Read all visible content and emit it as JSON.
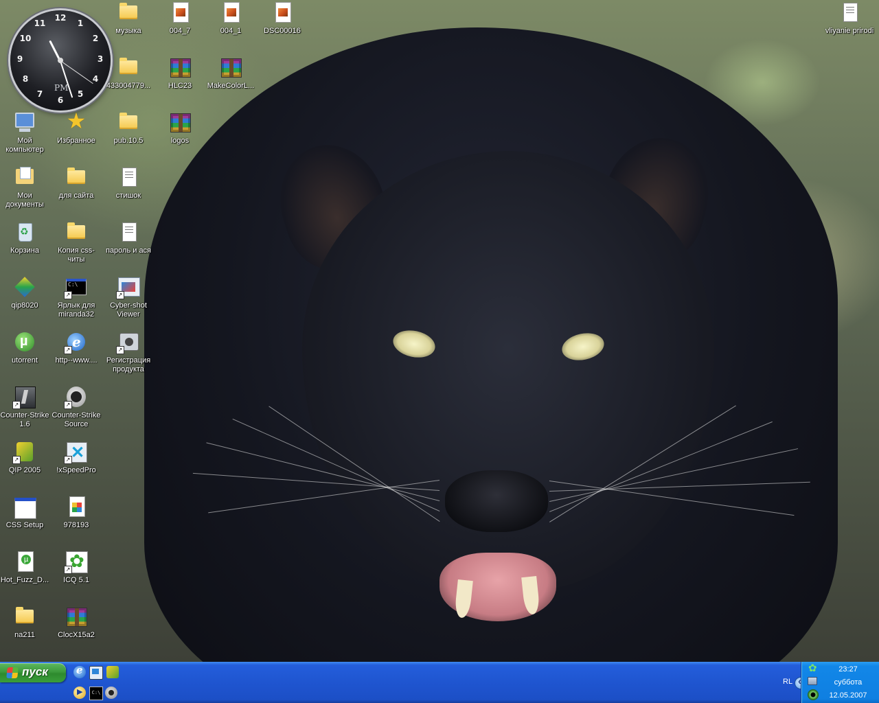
{
  "desktop": {
    "clock": {
      "numbers": [
        "12",
        "1",
        "2",
        "3",
        "4",
        "5",
        "6",
        "7",
        "8",
        "9",
        "10",
        "11"
      ],
      "meridiem": "PM"
    },
    "icons": [
      {
        "label": "музыка"
      },
      {
        "label": "004_7"
      },
      {
        "label": "004_1"
      },
      {
        "label": "DSC00016"
      },
      {
        "label": "vliyanie prirodi"
      },
      {
        "label": "433004779..."
      },
      {
        "label": "HLC23"
      },
      {
        "label": "MakeColorL..."
      },
      {
        "label": "Мой компьютер"
      },
      {
        "label": "Избранное"
      },
      {
        "label": "pub.10.5"
      },
      {
        "label": "logos"
      },
      {
        "label": "Мои документы"
      },
      {
        "label": "для сайта"
      },
      {
        "label": "стишок"
      },
      {
        "label": "Корзина"
      },
      {
        "label": "Копия css-читы"
      },
      {
        "label": "пароль и ася"
      },
      {
        "label": "qip8020"
      },
      {
        "label": "Ярлык для miranda32"
      },
      {
        "label": "Cyber-shot Viewer"
      },
      {
        "label": "utorrent"
      },
      {
        "label": "http--www...."
      },
      {
        "label": "Регистрация продукта"
      },
      {
        "label": "Counter-Strike 1.6"
      },
      {
        "label": "Counter-Strike Source"
      },
      {
        "label": "QIP 2005"
      },
      {
        "label": "!xSpeedPro"
      },
      {
        "label": "CSS Setup"
      },
      {
        "label": "978193"
      },
      {
        "label": "Hot_Fuzz_D..."
      },
      {
        "label": "ICQ 5.1"
      },
      {
        "label": "na211"
      },
      {
        "label": "ClocX15a2"
      }
    ]
  },
  "taskbar": {
    "start_label": "пуск",
    "quick_launch": [
      "internet-explorer-icon",
      "show-desktop-icon",
      "qip-icon",
      "media-player-icon",
      "command-prompt-icon",
      "counter-strike-icon"
    ],
    "tray": {
      "language": "RL",
      "time": "23:27",
      "day": "суббота",
      "date": "12.05.2007"
    }
  },
  "colors": {
    "taskbar": "#245edb",
    "start_button": "#3c9a3c",
    "tray": "#0f7fe1"
  }
}
